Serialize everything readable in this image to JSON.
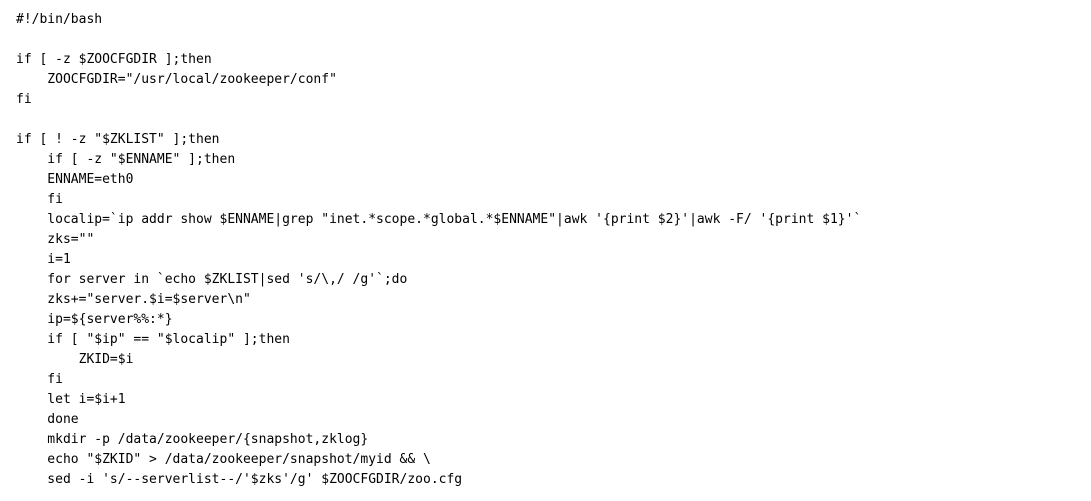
{
  "code": {
    "lines": [
      "#!/bin/bash",
      "",
      "if [ -z $ZOOCFGDIR ];then",
      "    ZOOCFGDIR=\"/usr/local/zookeeper/conf\"",
      "fi",
      "",
      "if [ ! -z \"$ZKLIST\" ];then",
      "    if [ -z \"$ENNAME\" ];then",
      "    ENNAME=eth0",
      "    fi",
      "    localip=`ip addr show $ENNAME|grep \"inet.*scope.*global.*$ENNAME\"|awk '{print $2}'|awk -F/ '{print $1}'`",
      "    zks=\"\"",
      "    i=1",
      "    for server in `echo $ZKLIST|sed 's/\\,/ /g'`;do",
      "    zks+=\"server.$i=$server\\n\"",
      "    ip=${server%%:*}",
      "    if [ \"$ip\" == \"$localip\" ];then",
      "        ZKID=$i",
      "    fi",
      "    let i=$i+1",
      "    done",
      "    mkdir -p /data/zookeeper/{snapshot,zklog}",
      "    echo \"$ZKID\" > /data/zookeeper/snapshot/myid && \\",
      "    sed -i 's/--serverlist--/'$zks'/g' $ZOOCFGDIR/zoo.cfg"
    ]
  }
}
